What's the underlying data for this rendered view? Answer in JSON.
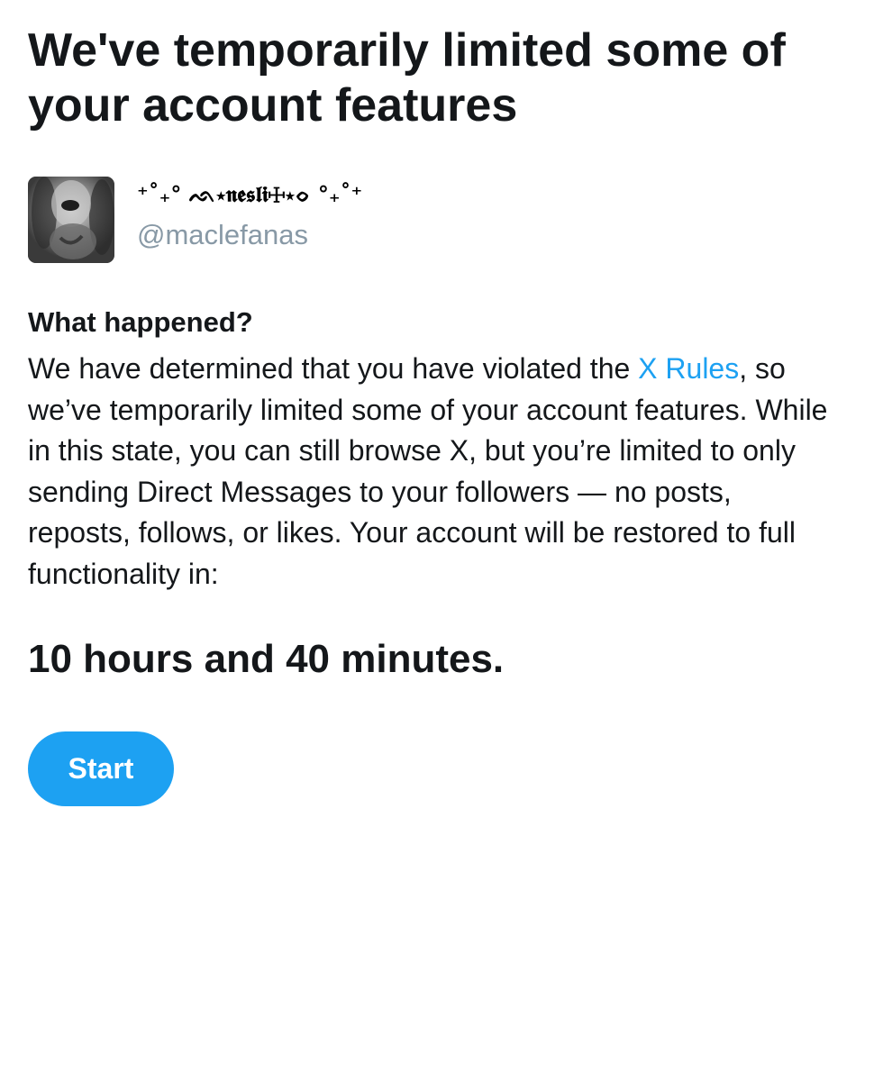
{
  "header": {
    "title": "We've temporarily limited some of your account features"
  },
  "account": {
    "display_name": "⁺˚₊° ᨒ⋆𝖓𝖊𝖘𝖑𝖎☩⋆ᨔ °₊˚⁺",
    "handle": "@maclefanas",
    "avatar_icon": "profile-photo"
  },
  "notice": {
    "heading": "What happened?",
    "body_before_link": "We have determined that you have violated the ",
    "link_text": "X Rules",
    "body_after_link": ", so we’ve temporarily limited some of your account features. While in this state, you can still browse X, but you’re limited to only sending Direct Messages to your followers — no posts, reposts, follows, or likes. Your account will be restored to full functionality in:",
    "time_remaining": "10 hours and 40 minutes."
  },
  "actions": {
    "start_label": "Start"
  },
  "colors": {
    "accent": "#1da1f2",
    "text": "#14171a",
    "secondary_text": "#8899a6",
    "background": "#ffffff"
  }
}
